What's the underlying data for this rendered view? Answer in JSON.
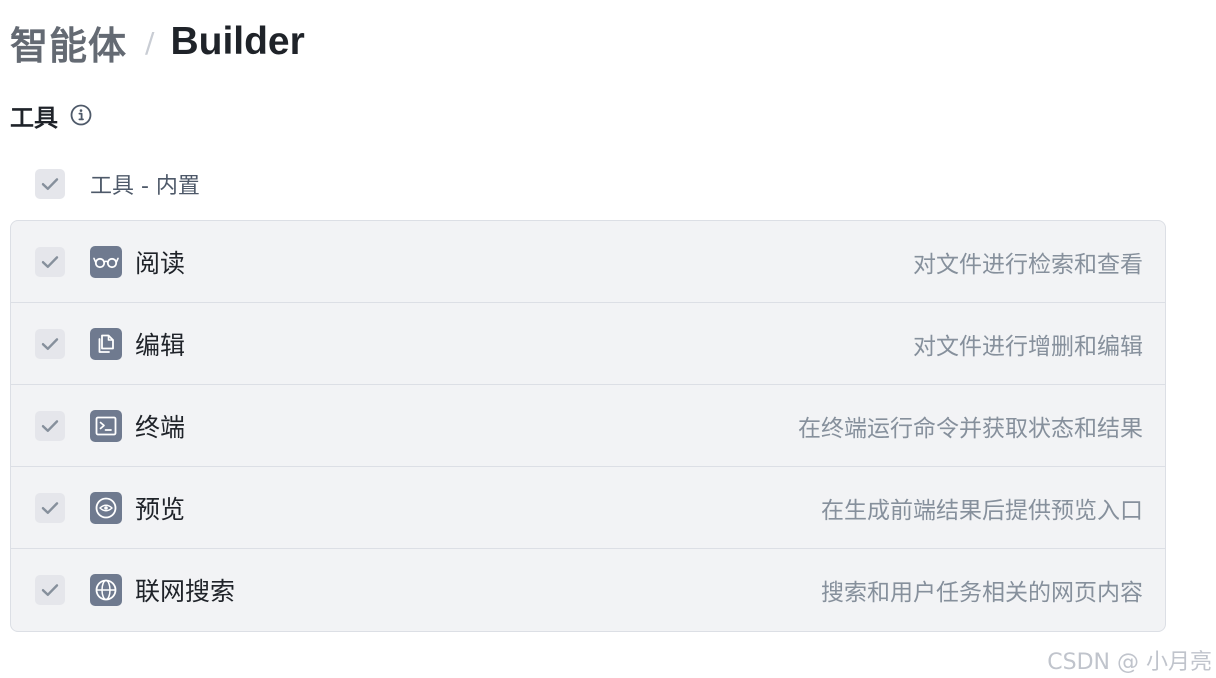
{
  "breadcrumb": {
    "root": "智能体",
    "separator": "/",
    "current": "Builder"
  },
  "section": {
    "title": "工具",
    "info_icon": "info-circle-icon"
  },
  "group": {
    "label": "工具 - 内置",
    "checked": true
  },
  "tools": [
    {
      "name": "阅读",
      "icon": "glasses-icon",
      "description": "对文件进行检索和查看",
      "checked": true
    },
    {
      "name": "编辑",
      "icon": "document-copy-icon",
      "description": "对文件进行增删和编辑",
      "checked": true
    },
    {
      "name": "终端",
      "icon": "terminal-icon",
      "description": "在终端运行命令并获取状态和结果",
      "checked": true
    },
    {
      "name": "预览",
      "icon": "eye-icon",
      "description": "在生成前端结果后提供预览入口",
      "checked": true
    },
    {
      "name": "联网搜索",
      "icon": "globe-icon",
      "description": "搜索和用户任务相关的网页内容",
      "checked": true
    }
  ],
  "watermark": "CSDN @  小月亮",
  "colors": {
    "checkbox_bg": "#e5e6eb",
    "checkmark": "#86909c",
    "tool_icon_bg": "#6f7a8f",
    "list_bg": "#f2f3f5",
    "text_primary": "#1f2329",
    "text_secondary": "#86909c"
  }
}
